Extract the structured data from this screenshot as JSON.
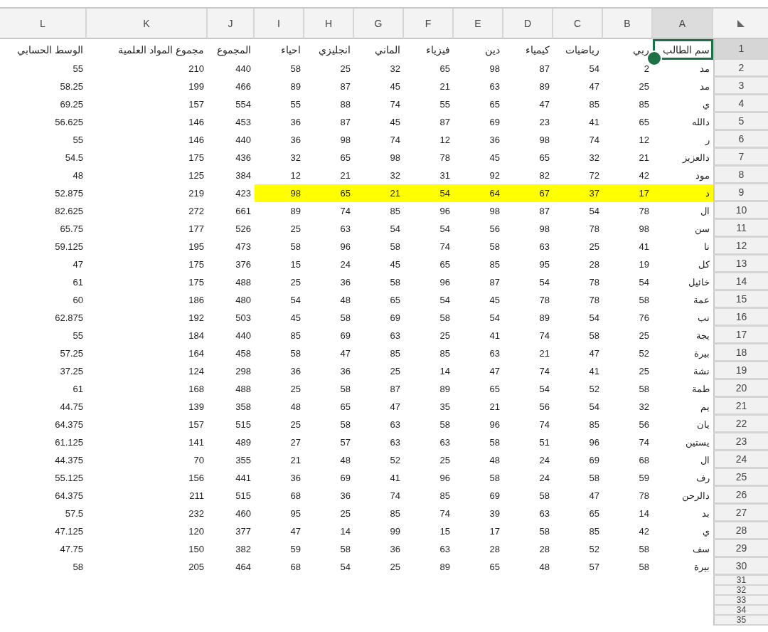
{
  "columns": [
    {
      "letter": "L",
      "selected": false
    },
    {
      "letter": "K",
      "selected": false
    },
    {
      "letter": "J",
      "selected": false
    },
    {
      "letter": "I",
      "selected": false
    },
    {
      "letter": "H",
      "selected": false
    },
    {
      "letter": "G",
      "selected": false
    },
    {
      "letter": "F",
      "selected": false
    },
    {
      "letter": "E",
      "selected": false
    },
    {
      "letter": "D",
      "selected": false
    },
    {
      "letter": "C",
      "selected": false
    },
    {
      "letter": "B",
      "selected": false
    },
    {
      "letter": "A",
      "selected": true
    }
  ],
  "header_row": {
    "number": "1",
    "selected": true,
    "cells": [
      "سم الطالب",
      "ربي",
      "رياضيات",
      "كيمياء",
      "دين",
      "فيزياء",
      "الماني",
      "انجليزي",
      "احياء",
      "المجموع",
      "مجموع المواد العلمية",
      "الوسط الحسابي"
    ]
  },
  "rows": [
    {
      "number": "2",
      "selected": false,
      "highlighted": false,
      "cells": [
        "55",
        "210",
        "440",
        "58",
        "25",
        "32",
        "65",
        "98",
        "87",
        "54",
        "2",
        "مد"
      ]
    },
    {
      "number": "3",
      "selected": false,
      "highlighted": false,
      "cells": [
        "58.25",
        "199",
        "466",
        "89",
        "87",
        "45",
        "21",
        "63",
        "89",
        "47",
        "25",
        "مد"
      ]
    },
    {
      "number": "4",
      "selected": false,
      "highlighted": false,
      "cells": [
        "69.25",
        "157",
        "554",
        "55",
        "88",
        "74",
        "55",
        "65",
        "47",
        "85",
        "85",
        "ي"
      ]
    },
    {
      "number": "5",
      "selected": false,
      "highlighted": false,
      "cells": [
        "56.625",
        "146",
        "453",
        "36",
        "87",
        "45",
        "87",
        "69",
        "23",
        "41",
        "65",
        "دالله"
      ]
    },
    {
      "number": "6",
      "selected": false,
      "highlighted": false,
      "cells": [
        "55",
        "146",
        "440",
        "36",
        "98",
        "74",
        "12",
        "36",
        "98",
        "74",
        "12",
        "ر"
      ]
    },
    {
      "number": "7",
      "selected": false,
      "highlighted": false,
      "cells": [
        "54.5",
        "175",
        "436",
        "32",
        "65",
        "98",
        "78",
        "45",
        "65",
        "32",
        "21",
        "دالعزيز"
      ]
    },
    {
      "number": "8",
      "selected": false,
      "highlighted": false,
      "cells": [
        "48",
        "125",
        "384",
        "12",
        "21",
        "32",
        "31",
        "92",
        "82",
        "72",
        "42",
        "مود"
      ]
    },
    {
      "number": "9",
      "selected": false,
      "highlighted": true,
      "cells": [
        "52.875",
        "219",
        "423",
        "98",
        "65",
        "21",
        "54",
        "64",
        "67",
        "37",
        "17",
        "د"
      ]
    },
    {
      "number": "10",
      "selected": false,
      "highlighted": false,
      "cells": [
        "82.625",
        "272",
        "661",
        "89",
        "74",
        "85",
        "96",
        "98",
        "87",
        "54",
        "78",
        "ال"
      ]
    },
    {
      "number": "11",
      "selected": false,
      "highlighted": false,
      "cells": [
        "65.75",
        "177",
        "526",
        "25",
        "63",
        "54",
        "54",
        "56",
        "98",
        "78",
        "98",
        "سن"
      ]
    },
    {
      "number": "12",
      "selected": false,
      "highlighted": false,
      "cells": [
        "59.125",
        "195",
        "473",
        "58",
        "96",
        "58",
        "74",
        "58",
        "63",
        "25",
        "41",
        "نا"
      ]
    },
    {
      "number": "13",
      "selected": false,
      "highlighted": false,
      "cells": [
        "47",
        "175",
        "376",
        "15",
        "24",
        "45",
        "65",
        "85",
        "95",
        "28",
        "19",
        "كل"
      ]
    },
    {
      "number": "14",
      "selected": false,
      "highlighted": false,
      "cells": [
        "61",
        "175",
        "488",
        "25",
        "36",
        "58",
        "96",
        "87",
        "54",
        "78",
        "54",
        "خائيل"
      ]
    },
    {
      "number": "15",
      "selected": false,
      "highlighted": false,
      "cells": [
        "60",
        "186",
        "480",
        "54",
        "48",
        "65",
        "54",
        "45",
        "78",
        "78",
        "58",
        "عمة"
      ]
    },
    {
      "number": "16",
      "selected": false,
      "highlighted": false,
      "cells": [
        "62.875",
        "192",
        "503",
        "45",
        "58",
        "69",
        "58",
        "54",
        "89",
        "54",
        "76",
        "نب"
      ]
    },
    {
      "number": "17",
      "selected": false,
      "highlighted": false,
      "cells": [
        "55",
        "184",
        "440",
        "85",
        "69",
        "63",
        "25",
        "41",
        "74",
        "58",
        "25",
        "يجة"
      ]
    },
    {
      "number": "18",
      "selected": false,
      "highlighted": false,
      "cells": [
        "57.25",
        "164",
        "458",
        "58",
        "47",
        "85",
        "85",
        "63",
        "21",
        "47",
        "52",
        "بيرة"
      ]
    },
    {
      "number": "19",
      "selected": false,
      "highlighted": false,
      "cells": [
        "37.25",
        "124",
        "298",
        "36",
        "36",
        "25",
        "14",
        "47",
        "74",
        "41",
        "25",
        "نشة"
      ]
    },
    {
      "number": "20",
      "selected": false,
      "highlighted": false,
      "cells": [
        "61",
        "168",
        "488",
        "25",
        "58",
        "87",
        "89",
        "65",
        "54",
        "52",
        "58",
        "طمة"
      ]
    },
    {
      "number": "21",
      "selected": false,
      "highlighted": false,
      "cells": [
        "44.75",
        "139",
        "358",
        "48",
        "65",
        "47",
        "35",
        "21",
        "56",
        "54",
        "32",
        "يم"
      ]
    },
    {
      "number": "22",
      "selected": false,
      "highlighted": false,
      "cells": [
        "64.375",
        "157",
        "515",
        "25",
        "58",
        "63",
        "58",
        "96",
        "74",
        "85",
        "56",
        "يان"
      ]
    },
    {
      "number": "23",
      "selected": false,
      "highlighted": false,
      "cells": [
        "61.125",
        "141",
        "489",
        "27",
        "57",
        "63",
        "63",
        "58",
        "51",
        "96",
        "74",
        "يستين"
      ]
    },
    {
      "number": "24",
      "selected": false,
      "highlighted": false,
      "cells": [
        "44.375",
        "70",
        "355",
        "21",
        "48",
        "52",
        "25",
        "48",
        "24",
        "69",
        "68",
        "ال"
      ]
    },
    {
      "number": "25",
      "selected": false,
      "highlighted": false,
      "cells": [
        "55.125",
        "156",
        "441",
        "36",
        "69",
        "41",
        "96",
        "58",
        "24",
        "58",
        "59",
        "رف"
      ]
    },
    {
      "number": "26",
      "selected": false,
      "highlighted": false,
      "cells": [
        "64.375",
        "211",
        "515",
        "68",
        "36",
        "74",
        "85",
        "69",
        "58",
        "47",
        "78",
        "دالرحن"
      ]
    },
    {
      "number": "27",
      "selected": false,
      "highlighted": false,
      "cells": [
        "57.5",
        "232",
        "460",
        "95",
        "25",
        "85",
        "74",
        "39",
        "63",
        "65",
        "14",
        "بد"
      ]
    },
    {
      "number": "28",
      "selected": false,
      "highlighted": false,
      "cells": [
        "47.125",
        "120",
        "377",
        "47",
        "14",
        "99",
        "15",
        "17",
        "58",
        "85",
        "42",
        "ي"
      ]
    },
    {
      "number": "29",
      "selected": false,
      "highlighted": false,
      "cells": [
        "47.75",
        "150",
        "382",
        "59",
        "58",
        "36",
        "63",
        "28",
        "28",
        "52",
        "58",
        "سف"
      ]
    },
    {
      "number": "30",
      "selected": false,
      "highlighted": false,
      "cells": [
        "58",
        "205",
        "464",
        "68",
        "54",
        "25",
        "89",
        "65",
        "48",
        "57",
        "58",
        "بيرة"
      ]
    },
    {
      "number": "31",
      "selected": false,
      "highlighted": false
    },
    {
      "number": "32",
      "selected": false,
      "highlighted": false
    },
    {
      "number": "33",
      "selected": false,
      "highlighted": false
    },
    {
      "number": "34",
      "selected": false,
      "highlighted": false
    },
    {
      "number": "35",
      "selected": false,
      "highlighted": false
    }
  ]
}
